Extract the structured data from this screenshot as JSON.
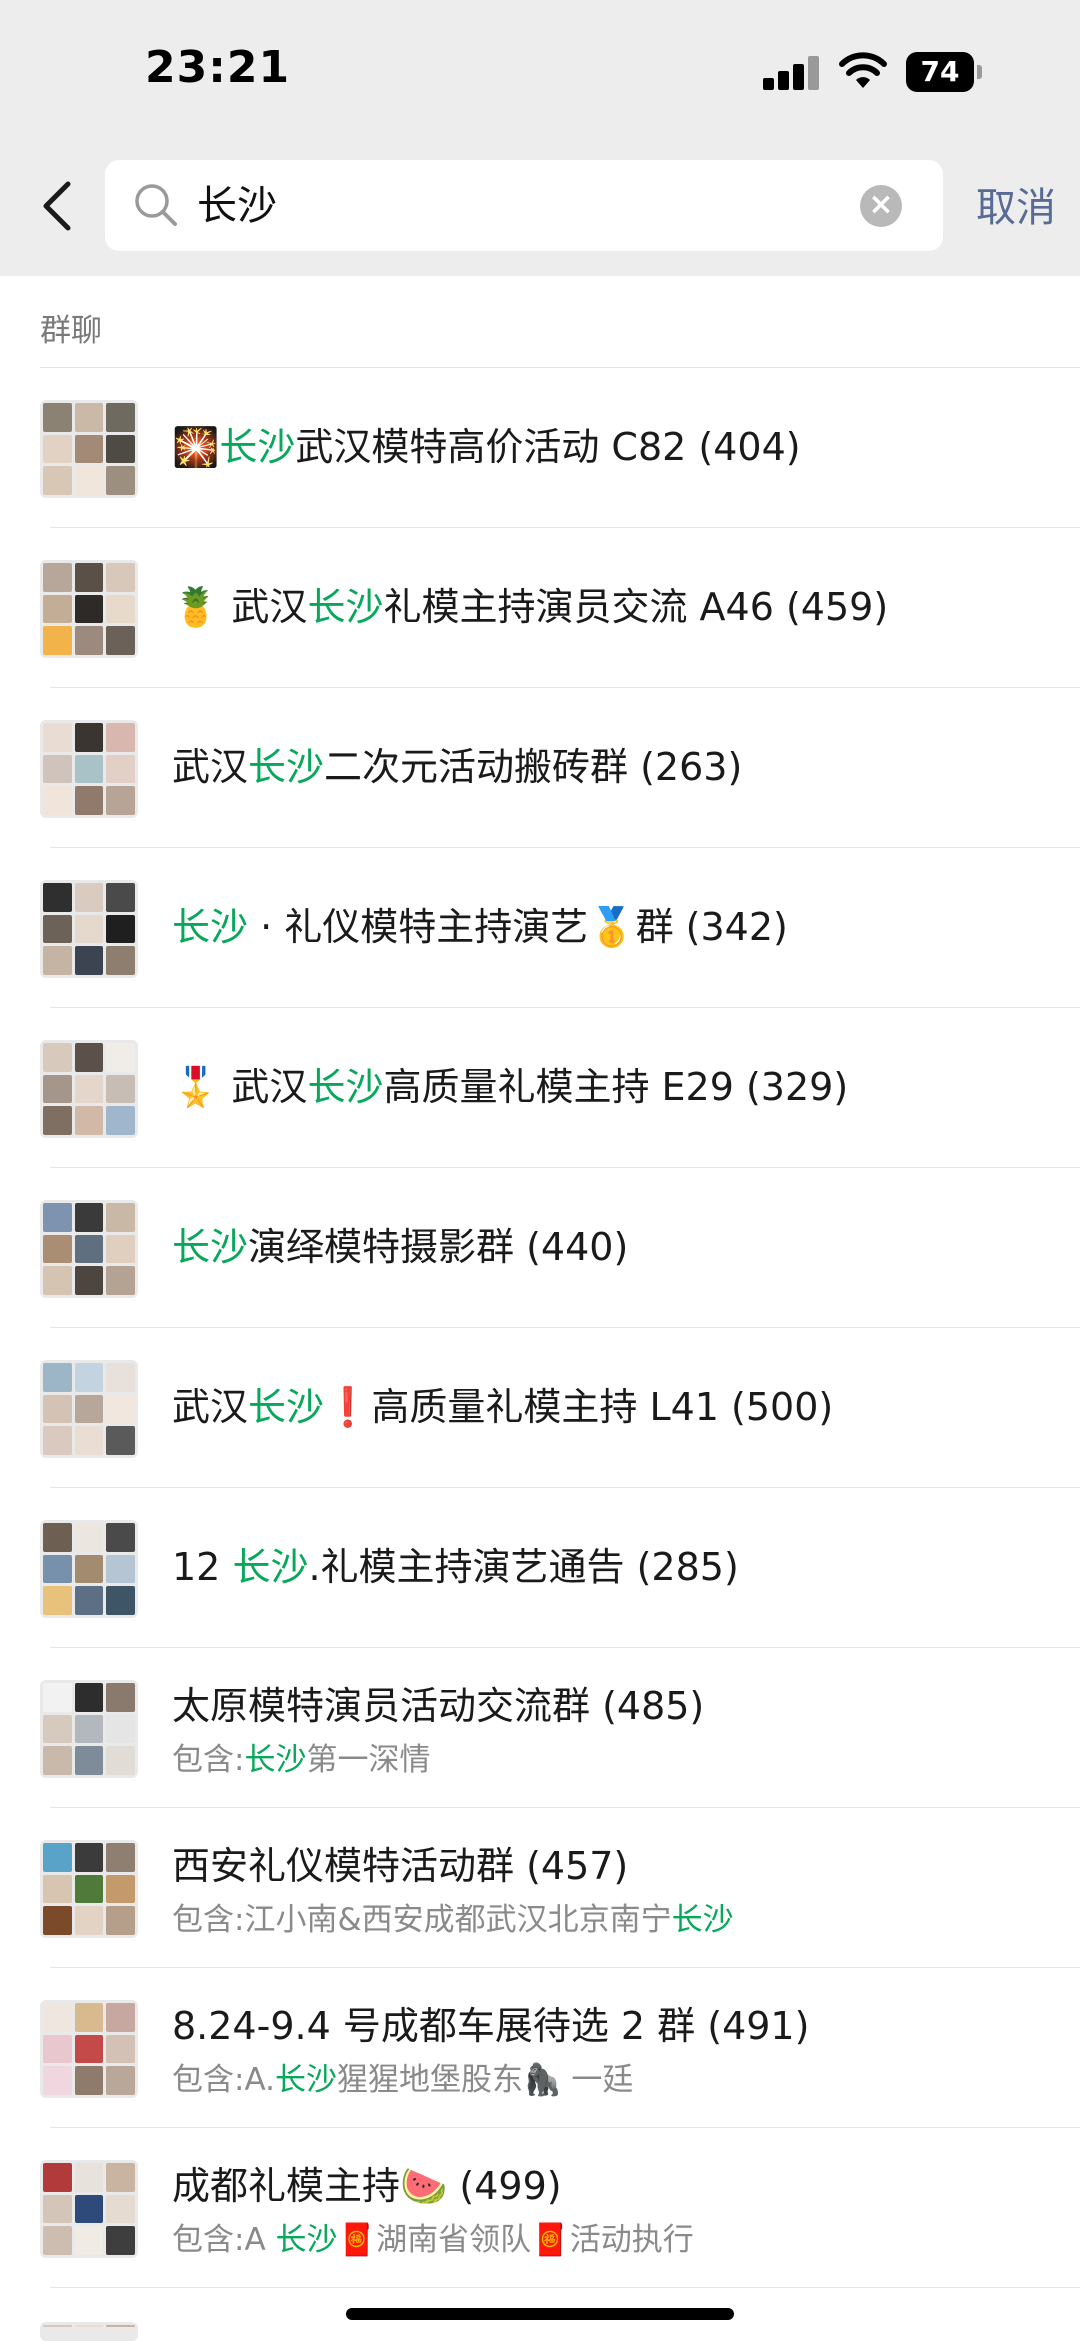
{
  "status": {
    "time": "23:21",
    "battery": "74"
  },
  "search": {
    "query": "长沙",
    "cancel": "取消"
  },
  "section": {
    "title": "群聊"
  },
  "rows": [
    {
      "prefix": "",
      "emoji": "🎇",
      "hl": "长沙",
      "rest": "武汉模特高价活动 C82 (404)",
      "sub_prefix": "",
      "sub_hl": "",
      "sub_rest": ""
    },
    {
      "prefix": "",
      "emoji": "🍍",
      "hl": "",
      "rest": "",
      "title_a": "武汉",
      "title_hl": "长沙",
      "title_b": "礼模主持演员交流 A46 (459)"
    },
    {
      "title_a": "武汉",
      "title_hl": "长沙",
      "title_b": "二次元活动搬砖群 (263)"
    },
    {
      "title_a": "",
      "title_hl": "长沙",
      "title_b": " · 礼仪模特主持演艺",
      "emoji2": "🥇",
      "title_c": "群 (342)"
    },
    {
      "emoji": "🎖️",
      "title_a": "武汉",
      "title_hl": "长沙",
      "title_b": "高质量礼模主持 E29 (329)"
    },
    {
      "title_a": "",
      "title_hl": "长沙",
      "title_b": "演绎模特摄影群 (440)"
    },
    {
      "title_a": "武汉",
      "title_hl": "长沙",
      "emoji2": "❗",
      "title_b": "",
      "title_c": "高质量礼模主持 L41 (500)"
    },
    {
      "title_a": "12 ",
      "title_hl": "长沙",
      "title_b": ".礼模主持演艺通告 (285)"
    },
    {
      "title": "太原模特演员活动交流群 (485)",
      "sub_a": "包含:",
      "sub_hl": "长沙",
      "sub_b": "第一深情"
    },
    {
      "title": "西安礼仪模特活动群 (457)",
      "sub_a": "包含:江小南&西安成都武汉北京南宁",
      "sub_hl": "长沙",
      "sub_b": ""
    },
    {
      "title": "8.24-9.4 号成都车展待选 2 群 (491)",
      "sub_a": "包含:A.",
      "sub_hl": "长沙",
      "sub_b": "猩猩地堡股东",
      "sub_emoji": "🦍",
      "sub_c": " 一廷"
    },
    {
      "title": "成都礼模主持",
      "title_emoji": "🍉",
      "title_tail": " (499)",
      "sub_a": "包含:A ",
      "sub_hl": "长沙",
      "sub_emoji1": "🧧",
      "sub_b": "湖南省领队",
      "sub_emoji2": "🧧",
      "sub_c": "活动执行"
    }
  ]
}
